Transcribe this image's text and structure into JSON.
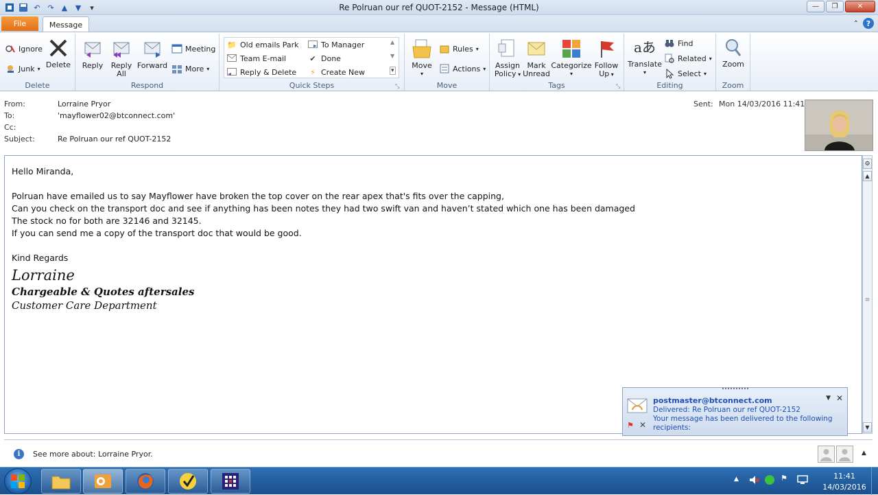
{
  "window": {
    "title": "Re Polruan our ref QUOT-2152  -  Message (HTML)"
  },
  "tabs": {
    "file": "File",
    "message": "Message"
  },
  "ribbon": {
    "delete_group": {
      "label": "Delete",
      "ignore": "Ignore",
      "junk": "Junk",
      "delete": "Delete"
    },
    "respond_group": {
      "label": "Respond",
      "reply": "Reply",
      "reply_all_1": "Reply",
      "reply_all_2": "All",
      "forward": "Forward",
      "meeting": "Meeting",
      "more": "More"
    },
    "quick_steps": {
      "label": "Quick Steps",
      "items": [
        "Old emails Park",
        "Team E-mail",
        "Reply & Delete",
        "To Manager",
        "Done",
        "Create New"
      ]
    },
    "move_group": {
      "label": "Move",
      "move": "Move",
      "rules": "Rules",
      "actions": "Actions"
    },
    "tags_group": {
      "label": "Tags",
      "assign_1": "Assign",
      "assign_2": "Policy",
      "mark_1": "Mark",
      "mark_2": "Unread",
      "categorize": "Categorize",
      "follow_1": "Follow",
      "follow_2": "Up"
    },
    "editing_group": {
      "label": "Editing",
      "translate": "Translate",
      "find": "Find",
      "related": "Related",
      "select": "Select"
    },
    "zoom_group": {
      "label": "Zoom",
      "zoom": "Zoom"
    }
  },
  "header": {
    "from_label": "From:",
    "from": "Lorraine Pryor",
    "to_label": "To:",
    "to": "'mayflower02@btconnect.com'",
    "cc_label": "Cc:",
    "subject_label": "Subject:",
    "subject": "Re Polruan our ref QUOT-2152",
    "sent_label": "Sent:",
    "sent": "Mon 14/03/2016 11:41"
  },
  "body": {
    "greeting": "Hello Miranda,",
    "lines": [
      "Polruan have emailed us to say  Mayflower have broken the top cover on the rear apex that's fits over the capping,",
      "Can you check on the transport doc and see if anything has been notes they had two swift van and haven’t stated which one has been damaged",
      "The stock no for both are 32146 and 32145.",
      "If you can send me a copy of the transport doc that would be good."
    ],
    "closing": "Kind Regards",
    "signature_name": "Lorraine",
    "signature_title": "Chargeable & Quotes aftersales",
    "signature_dept": "Customer Care Department"
  },
  "notification": {
    "sender": "postmaster@btconnect.com",
    "subject": "Delivered: Re Polruan our ref QUOT-2152",
    "text_1": "Your message has been delivered to the following",
    "text_2": "recipients:"
  },
  "people_pane": {
    "text": "See more about: Lorraine Pryor."
  },
  "taskbar": {
    "time": "11:41",
    "date": "14/03/2016"
  },
  "colors": {
    "file_tab": "#e07017",
    "link_blue": "#1f4fb4",
    "taskbar": "#1b4f8d"
  }
}
